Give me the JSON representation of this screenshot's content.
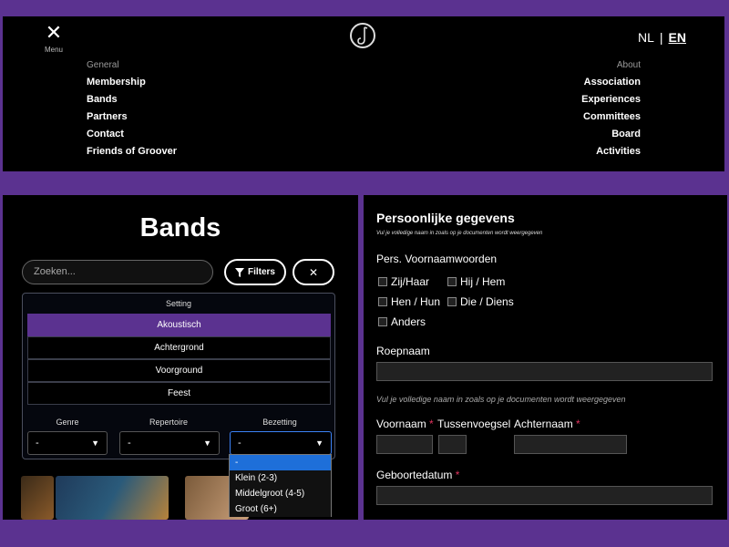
{
  "header": {
    "menu_label": "Menu",
    "lang": {
      "nl": "NL",
      "separator": "|",
      "en": "EN"
    },
    "general": {
      "heading": "General",
      "links": [
        "Membership",
        "Bands",
        "Partners",
        "Contact",
        "Friends of Groover"
      ]
    },
    "about": {
      "heading": "About",
      "links": [
        "Association",
        "Experiences",
        "Committees",
        "Board",
        "Activities"
      ]
    }
  },
  "bands": {
    "title": "Bands",
    "search_placeholder": "Zoeken...",
    "filters_label": "Filters",
    "clear_label": "✕",
    "setting_label": "Setting",
    "setting_options": [
      "Akoustisch",
      "Achtergrond",
      "Voorground",
      "Feest"
    ],
    "selected_setting": "Akoustisch",
    "selects": [
      {
        "label": "Genre",
        "value": "-"
      },
      {
        "label": "Repertoire",
        "value": "-"
      },
      {
        "label": "Bezetting",
        "value": "-"
      }
    ],
    "bezetting_options": [
      "-",
      "Klein (2-3)",
      "Middelgroot (4-5)",
      "Groot (6+)"
    ]
  },
  "form": {
    "title": "Persoonlijke gegevens",
    "subtitle": "Vul je volledige naam in zoals op je documenten wordt weergegeven",
    "pronouns_label": "Pers. Voornaamwoorden",
    "pronouns": [
      "Zij/Haar",
      "Hij / Hem",
      "Hen / Hun",
      "Die / Diens",
      "Anders"
    ],
    "roepnaam_label": "Roepnaam",
    "hint": "Vul je volledige naam in zoals op je documenten wordt weergegeven",
    "voornaam_label": "Voornaam",
    "tussenvoegsel_label": "Tussenvoegsel",
    "achternaam_label": "Achternaam",
    "required_mark": "*",
    "geboortedatum_label": "Geboortedatum"
  },
  "colors": {
    "accent": "#5b3290",
    "required": "#e0335e",
    "focus": "#3b82f6"
  }
}
